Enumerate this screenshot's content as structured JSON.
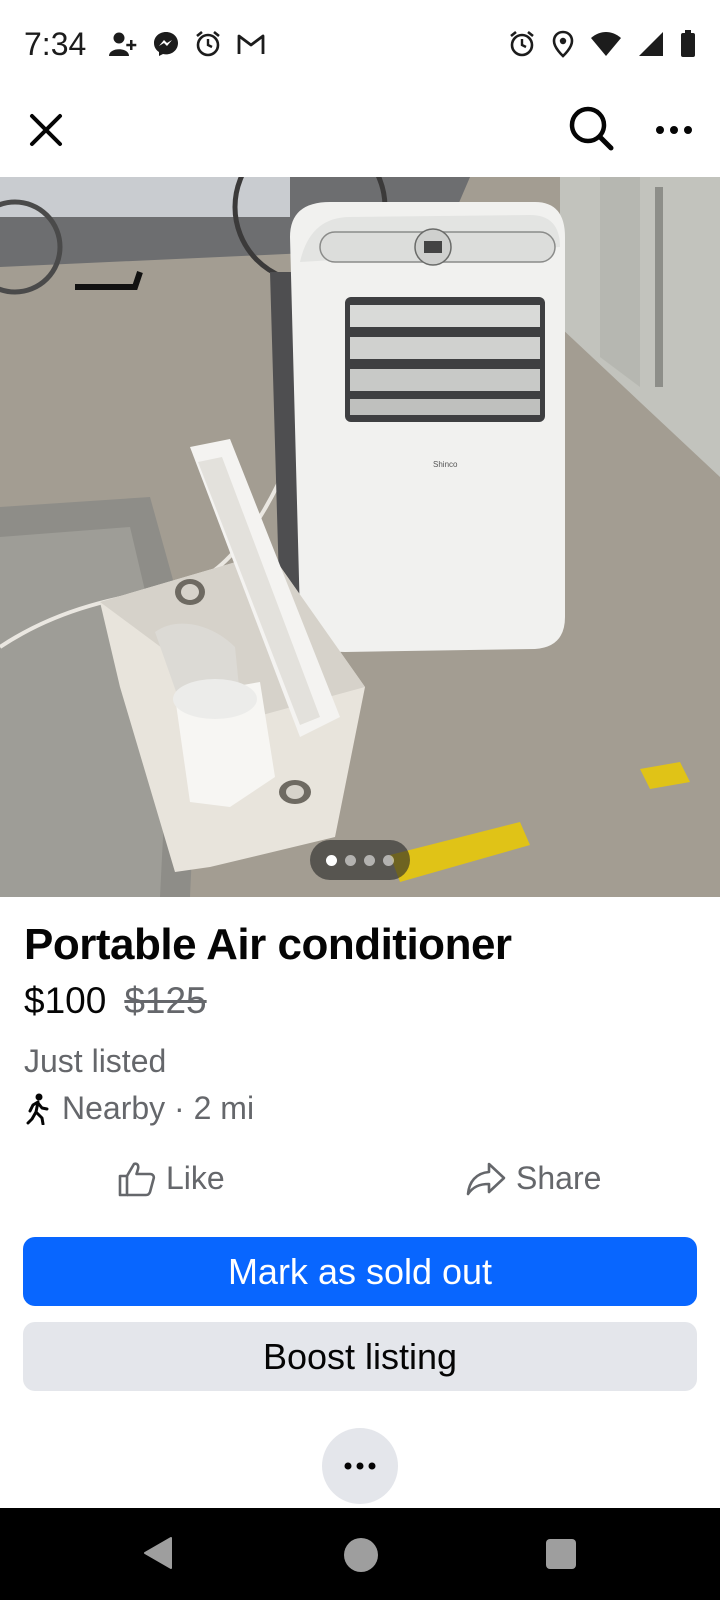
{
  "status_bar": {
    "time": "7:34",
    "left_icons": [
      "person-add-icon",
      "messenger-icon",
      "alarm-icon",
      "gmail-icon"
    ],
    "right_icons": [
      "alarm-icon",
      "location-icon",
      "wifi-icon",
      "signal-icon",
      "battery-icon"
    ]
  },
  "top_nav": {
    "close_icon": "close-icon",
    "search_icon": "search-icon",
    "more_icon": "more-horizontal-icon"
  },
  "photo": {
    "brand_text": "Shinco",
    "pager": {
      "count": 4,
      "active_index": 0
    }
  },
  "listing": {
    "title": "Portable Air conditioner",
    "price": "$100",
    "original_price": "$125",
    "listed_status": "Just listed",
    "location_text": "Nearby · 2 mi"
  },
  "actions": {
    "like_label": "Like",
    "share_label": "Share"
  },
  "buttons": {
    "mark_sold_label": "Mark as sold out",
    "boost_label": "Boost listing"
  },
  "colors": {
    "primary": "#0866ff",
    "secondary_bg": "#e4e6eb",
    "muted_text": "#65676b"
  }
}
